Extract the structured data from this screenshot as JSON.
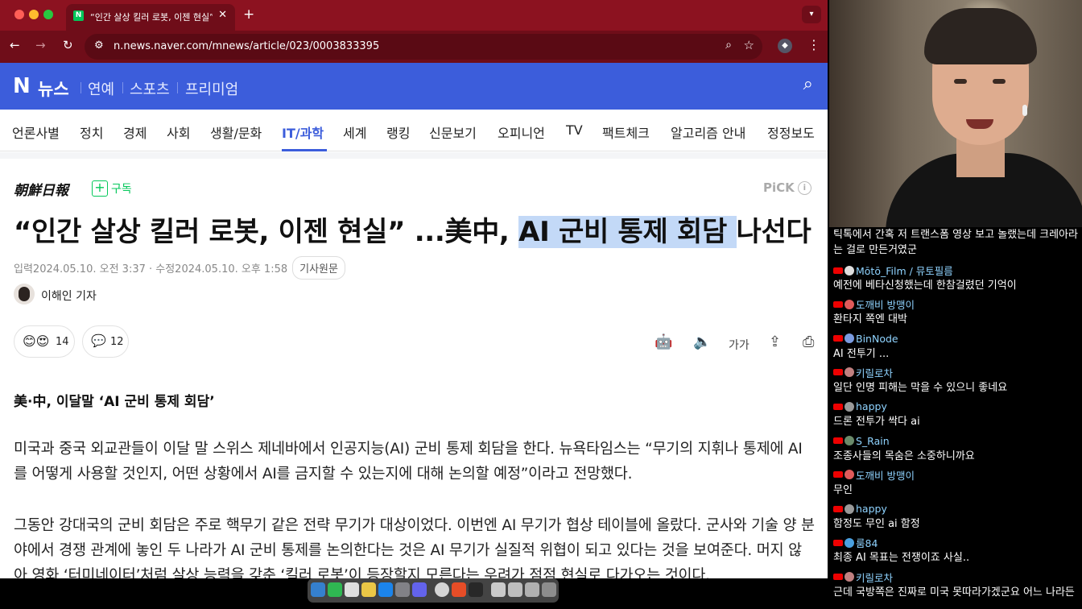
{
  "browser": {
    "tab_title": "“인간 살상 킬러 로봇, 이젠 현실” ...",
    "tab_favicon": "N",
    "new_tab": "+",
    "url": "n.news.naver.com/mnews/article/023/0003833395"
  },
  "naver": {
    "logo": "N",
    "news": "뉴스",
    "sections": [
      "연예",
      "스포츠",
      "프리미엄"
    ]
  },
  "categories": [
    "언론사별",
    "정치",
    "경제",
    "사회",
    "생활/문화",
    "IT/과학",
    "세계",
    "랭킹",
    "신문보기",
    "오피니언",
    "TV",
    "팩트체크",
    "알고리즘 안내",
    "정정보도"
  ],
  "active_category": "IT/과학",
  "article": {
    "press": "朝鮮日報",
    "subscribe_icon": "+",
    "subscribe_label": "구독",
    "pick": "PiCK",
    "pick_info": "i",
    "headline_pre": "“인간 살상 킬러 로봇, 이젠 현실” ...美中, ",
    "headline_highlight": "AI 군비 통제 회담 ",
    "headline_post": "나선다",
    "meta_text": "입력2024.05.10. 오전 3:37 · 수정2024.05.10. 오후 1:58",
    "original_link": "기사원문",
    "author": "이해인 기자",
    "reactions": "14",
    "comments": "12",
    "font_size_label": "가가",
    "subheading": "美·中, 이달말 ‘AI 군비 통제 회담’",
    "para1": "미국과 중국 외교관들이 이달 말 스위스 제네바에서 인공지능(AI) 군비 통제 회담을 한다. 뉴욕타임스는 “무기의 지휘나 통제에 AI를 어떻게 사용할 것인지, 어떤 상황에서 AI를 금지할 수 있는지에 대해 논의할 예정”이라고 전망했다.",
    "para2": "그동안 강대국의 군비 회담은 주로 핵무기 같은 전략 무기가 대상이었다. 이번엔 AI 무기가 협상 테이블에 올랐다. 군사와 기술 양 분야에서 경쟁 관계에 놓인 두 나라가 AI 군비 통제를 논의한다는 것은 AI 무기가 실질적 위협이 되고 있다는 것을 보여준다. 머지 않아 영화 ‘터미네이터’처럼 살상 능력을 갖춘 ‘킬러 로봇’이 등장할지 모른다는 우려가 점점 현실로 다가오는 것이다."
  },
  "chat": {
    "top_text": "틱톡에서 간혹 저 트랜스폼 영상 보고 놀랬는데 크레아라는 걸로 만든거였군",
    "messages": [
      {
        "name": "Mōtō_Film / 뮤토필름",
        "text": "예전에 베타신청했는데 한참걸렸던 기억이",
        "color": "#8fd3ff",
        "avatar": "#ddd"
      },
      {
        "name": "도깨비 방맹이",
        "text": "환타지 쪽엔 대박",
        "color": "#8fd3ff",
        "avatar": "#e05a5a"
      },
      {
        "name": "BinNode",
        "text": "AI 전투기 ...",
        "color": "#8fd3ff",
        "avatar": "#7a9be0"
      },
      {
        "name": "키릴로차",
        "text": "일단 인명 피해는 막을 수 있으니 좋네요",
        "color": "#8fd3ff",
        "avatar": "#c08080"
      },
      {
        "name": "happy",
        "text": "드론 전투가 싹다 ai",
        "color": "#8fd3ff",
        "avatar": "#999"
      },
      {
        "name": "S_Rain",
        "text": "조종사들의 목숨은 소중하니까요",
        "color": "#8fd3ff",
        "avatar": "#6a8a6a"
      },
      {
        "name": "도깨비 방맹이",
        "text": "무인",
        "color": "#8fd3ff",
        "avatar": "#e05a5a"
      },
      {
        "name": "happy",
        "text": "함정도 무인 ai 함정",
        "color": "#8fd3ff",
        "avatar": "#999"
      },
      {
        "name": "룸84",
        "text": "최종 AI 목표는 전쟁이죠 사실..",
        "color": "#8fd3ff",
        "avatar": "#4aa0e0"
      },
      {
        "name": "키릴로차",
        "text": "근데 국방쪽은 진짜로 미국 못따라가겠군요 어느 나라든",
        "color": "#8fd3ff",
        "avatar": "#c08080"
      }
    ]
  }
}
